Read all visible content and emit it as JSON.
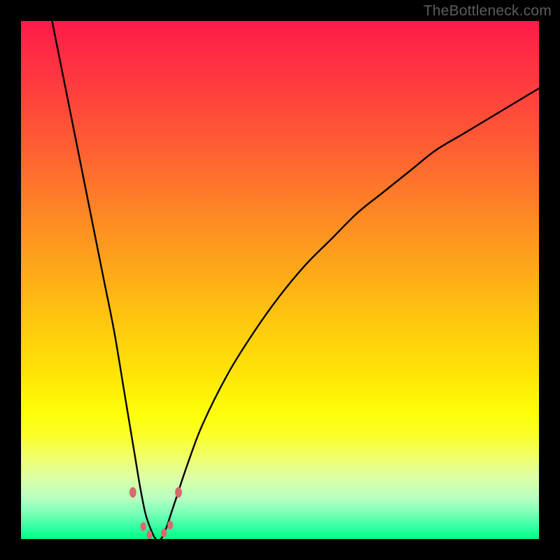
{
  "watermark": "TheBottleneck.com",
  "chart_data": {
    "type": "line",
    "title": "",
    "xlabel": "",
    "ylabel": "",
    "xlim": [
      0,
      100
    ],
    "ylim": [
      0,
      100
    ],
    "series": [
      {
        "name": "bottleneck-curve",
        "x": [
          6,
          8,
          10,
          12,
          14,
          16,
          18,
          20,
          21,
          22,
          23,
          24,
          25,
          26,
          27,
          28,
          29,
          30,
          32,
          35,
          40,
          45,
          50,
          55,
          60,
          65,
          70,
          75,
          80,
          85,
          90,
          95,
          100
        ],
        "values": [
          100,
          90,
          80,
          70,
          60,
          50,
          40,
          28,
          22,
          16,
          10,
          5,
          2,
          0,
          0,
          2,
          5,
          8,
          14,
          22,
          32,
          40,
          47,
          53,
          58,
          63,
          67,
          71,
          75,
          78,
          81,
          84,
          87
        ]
      }
    ],
    "markers": [
      {
        "x": 21.6,
        "y": 9.0,
        "r": 1.2
      },
      {
        "x": 23.6,
        "y": 2.4,
        "r": 1.0
      },
      {
        "x": 24.8,
        "y": 0.8,
        "r": 1.0
      },
      {
        "x": 27.6,
        "y": 1.2,
        "r": 1.0
      },
      {
        "x": 28.8,
        "y": 2.7,
        "r": 1.0
      },
      {
        "x": 30.4,
        "y": 9.0,
        "r": 1.2
      }
    ],
    "marker_color": "#d86a6a",
    "curve_color": "#000000",
    "gradient_stops": [
      {
        "pct": 0,
        "color": "#ff1a4a"
      },
      {
        "pct": 50,
        "color": "#fea21b"
      },
      {
        "pct": 78,
        "color": "#feff08"
      },
      {
        "pct": 100,
        "color": "#00ff84"
      }
    ]
  }
}
